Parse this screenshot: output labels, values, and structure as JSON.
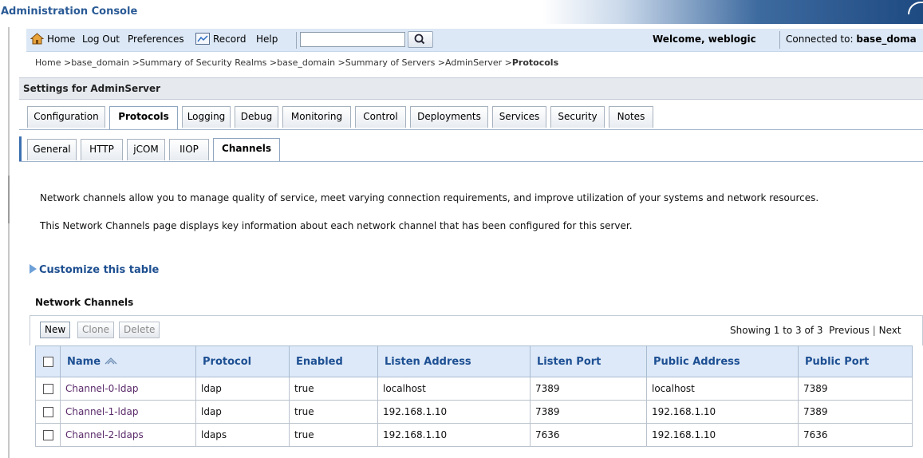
{
  "app": {
    "title": "Administration Console"
  },
  "toolbar": {
    "home_label": "Home",
    "logout_label": "Log Out",
    "preferences_label": "Preferences",
    "record_label": "Record",
    "help_label": "Help",
    "search_value": "",
    "welcome_text": "Welcome, weblogic",
    "connected_label": "Connected to:",
    "connected_value": "base_doma"
  },
  "breadcrumb": {
    "trail": "Home >base_domain >Summary of Security Realms >base_domain >Summary of Servers >AdminServer >",
    "current": "Protocols"
  },
  "settings": {
    "title": "Settings for AdminServer"
  },
  "tabs": [
    {
      "label": "Configuration"
    },
    {
      "label": "Protocols"
    },
    {
      "label": "Logging"
    },
    {
      "label": "Debug"
    },
    {
      "label": "Monitoring"
    },
    {
      "label": "Control"
    },
    {
      "label": "Deployments"
    },
    {
      "label": "Services"
    },
    {
      "label": "Security"
    },
    {
      "label": "Notes"
    }
  ],
  "subtabs": [
    {
      "label": "General"
    },
    {
      "label": "HTTP"
    },
    {
      "label": "jCOM"
    },
    {
      "label": "IIOP"
    },
    {
      "label": "Channels"
    }
  ],
  "content": {
    "description1": "Network channels allow you to manage quality of service, meet varying connection requirements, and improve utilization of your systems and network resources.",
    "description2": "This Network Channels page displays key information about each network channel that has been configured for this server.",
    "customize_label": "Customize this table"
  },
  "table": {
    "title": "Network Channels",
    "buttons": {
      "new": "New",
      "clone": "Clone",
      "delete": "Delete"
    },
    "showing_text": "Showing 1 to 3 of 3",
    "previous_label": "Previous",
    "next_label": "Next",
    "columns": [
      "Name",
      "Protocol",
      "Enabled",
      "Listen Address",
      "Listen Port",
      "Public Address",
      "Public Port"
    ],
    "rows": [
      [
        "Channel-0-ldap",
        "ldap",
        "true",
        "localhost",
        "7389",
        "localhost",
        "7389"
      ],
      [
        "Channel-1-ldap",
        "ldap",
        "true",
        "192.168.1.10",
        "7389",
        "192.168.1.10",
        "7389"
      ],
      [
        "Channel-2-ldaps",
        "ldaps",
        "true",
        "192.168.1.10",
        "7636",
        "192.168.1.10",
        "7636"
      ]
    ]
  },
  "icons": {
    "home": "home-icon",
    "record": "record-icon",
    "search": "search-icon",
    "customize": "expand-triangle-icon",
    "sort": "sort-ascending-icon"
  },
  "colors": {
    "brand": "#2a5a96",
    "header_bg": "#dde9f8",
    "link": "#1e4f90",
    "visited_link": "#5a2a6a"
  }
}
